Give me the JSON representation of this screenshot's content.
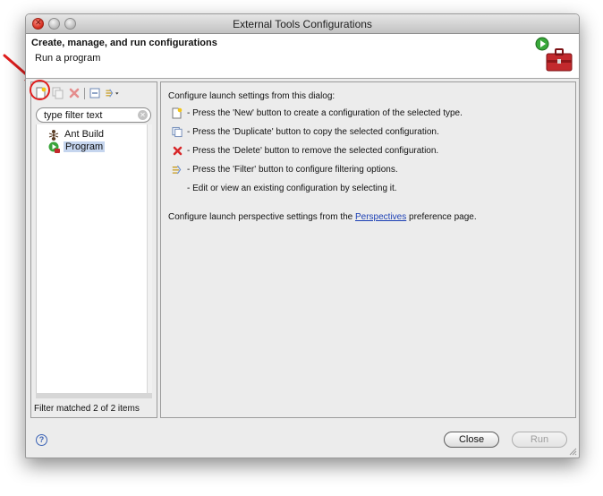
{
  "window": {
    "title": "External Tools Configurations"
  },
  "banner": {
    "title": "Create, manage, and run configurations",
    "subtitle": "Run a program"
  },
  "toolbar": {
    "icons": [
      "new-configuration-icon",
      "duplicate-icon",
      "delete-icon",
      "collapse-all-icon",
      "filter-icon",
      "dropdown-arrow-icon"
    ]
  },
  "filter": {
    "placeholder": "type filter text",
    "value": "type filter text"
  },
  "tree": {
    "items": [
      {
        "label": "Ant Build",
        "icon": "ant-icon"
      },
      {
        "label": "Program",
        "icon": "program-run-icon",
        "selected": true
      }
    ]
  },
  "status": {
    "match_text": "Filter matched 2 of 2 items"
  },
  "help": {
    "intro": "Configure launch settings from this dialog:",
    "items": [
      {
        "icon": "new-configuration-icon",
        "text": "- Press the 'New' button to create a configuration of the selected type."
      },
      {
        "icon": "duplicate-icon",
        "text": "- Press the 'Duplicate' button to copy the selected configuration."
      },
      {
        "icon": "delete-icon",
        "text": "- Press the 'Delete' button to remove the selected configuration."
      },
      {
        "icon": "filter-icon",
        "text": "- Press the 'Filter' button to configure filtering options."
      },
      {
        "icon": "",
        "text": "- Edit or view an existing configuration by selecting it."
      }
    ],
    "perspective_prefix": "Configure launch perspective settings from the ",
    "perspective_link": "Perspectives",
    "perspective_suffix": " preference page."
  },
  "buttons": {
    "close": "Close",
    "run": "Run"
  },
  "colors": {
    "accent_red": "#e01e1e",
    "link_blue": "#1b3fb4",
    "selection": "#c5d5ee"
  }
}
